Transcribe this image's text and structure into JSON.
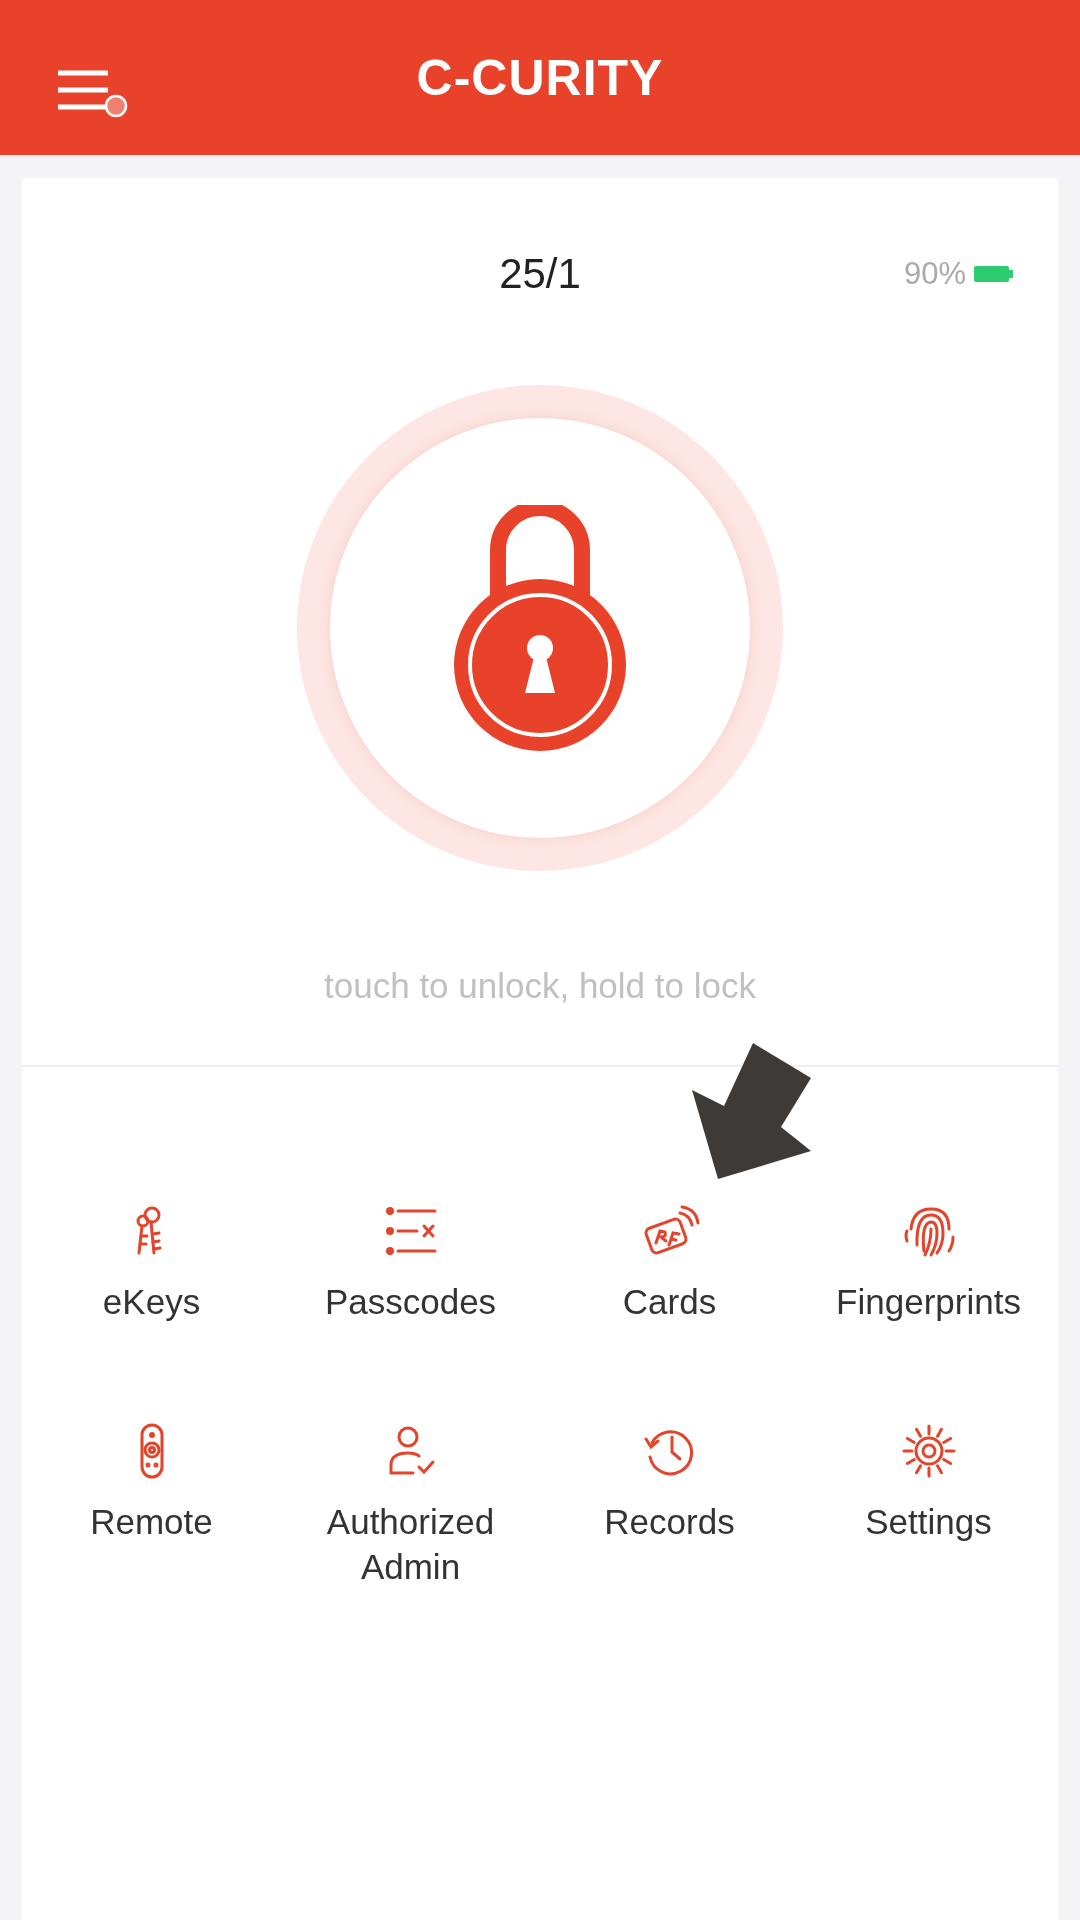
{
  "header": {
    "title": "C-CURITY",
    "menu_badge": true
  },
  "status": {
    "date": "25/1",
    "battery": "90%"
  },
  "lock": {
    "hint": "touch to unlock, hold to lock"
  },
  "features": [
    {
      "kind": "ekeys",
      "label": "eKeys"
    },
    {
      "kind": "passcodes",
      "label": "Passcodes"
    },
    {
      "kind": "cards",
      "label": "Cards"
    },
    {
      "kind": "fingerprints",
      "label": "Fingerprints"
    },
    {
      "kind": "remote",
      "label": "Remote"
    },
    {
      "kind": "admin",
      "label": "Authorized Admin"
    },
    {
      "kind": "records",
      "label": "Records"
    },
    {
      "kind": "settings",
      "label": "Settings"
    }
  ]
}
